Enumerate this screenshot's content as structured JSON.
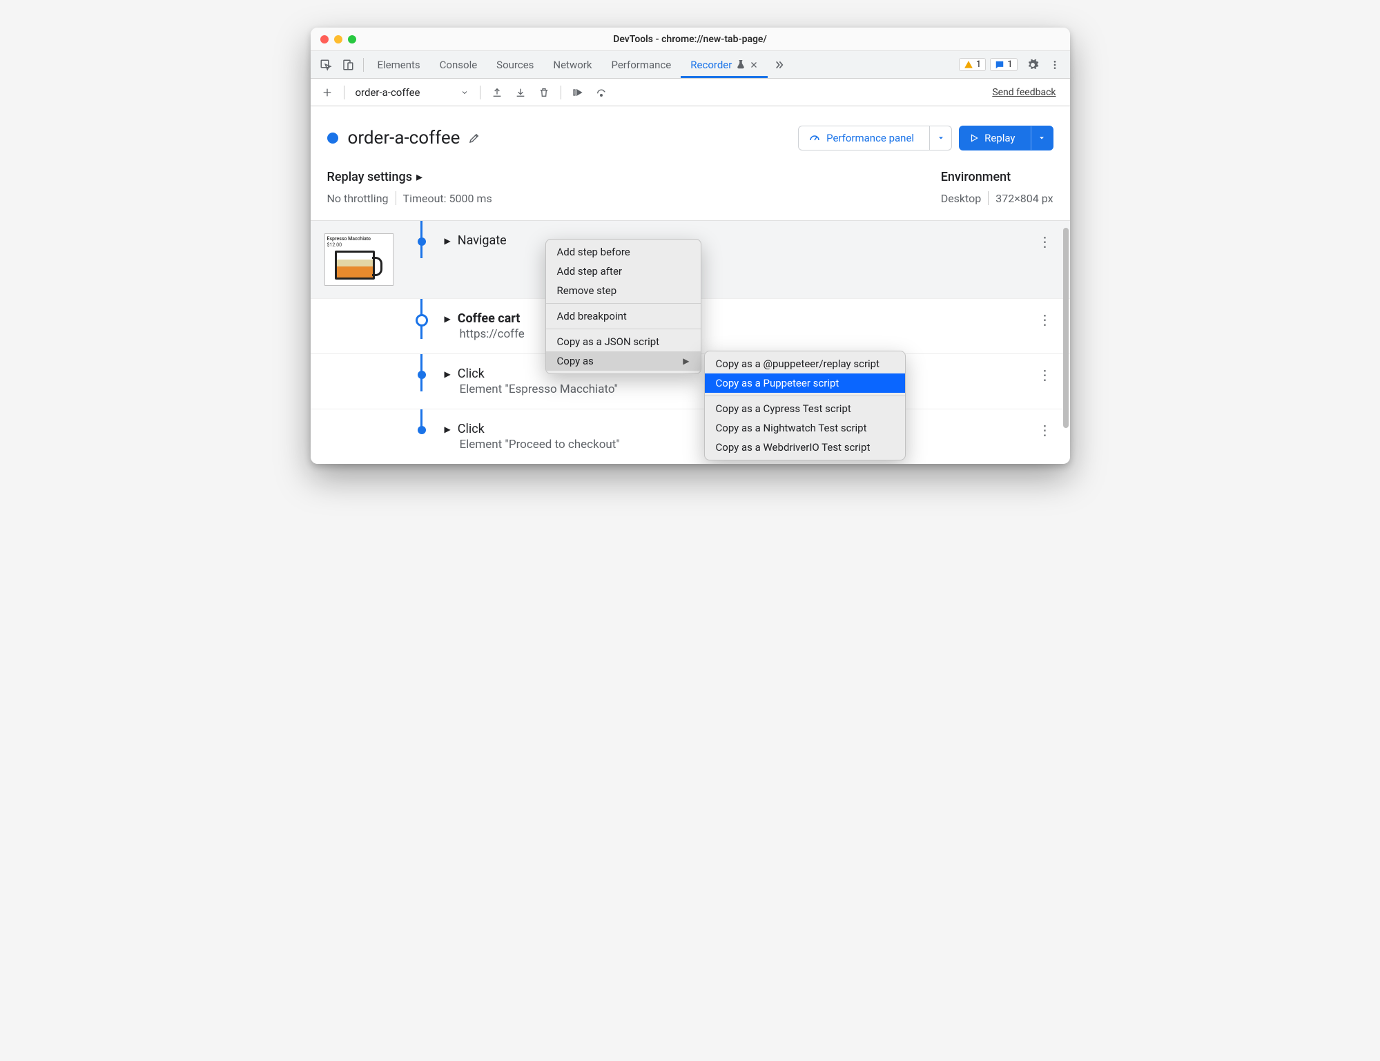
{
  "window": {
    "title": "DevTools - chrome://new-tab-page/"
  },
  "tabs": {
    "items": [
      "Elements",
      "Console",
      "Sources",
      "Network",
      "Performance"
    ],
    "recorder": "Recorder",
    "warnings_count": "1",
    "messages_count": "1"
  },
  "toolbar": {
    "recording_name": "order-a-coffee",
    "send_feedback": "Send feedback"
  },
  "header": {
    "recording_title": "order-a-coffee",
    "perf_button": "Performance panel",
    "replay_button": "Replay"
  },
  "settings": {
    "replay_label": "Replay settings",
    "throttling": "No throttling",
    "timeout": "Timeout: 5000 ms",
    "env_label": "Environment",
    "env_device": "Desktop",
    "env_size": "372×804 px"
  },
  "thumb": {
    "label1": "Espresso Macchiato",
    "label2": "$12.00",
    "foam": "milk foam",
    "fill": "espresso"
  },
  "steps": [
    {
      "title": "Navigate",
      "bold": false,
      "subtitle": ""
    },
    {
      "title": "Coffee cart",
      "bold": true,
      "subtitle": "https://coffe"
    },
    {
      "title": "Click",
      "bold": false,
      "subtitle": "Element \"Espresso Macchiato\""
    },
    {
      "title": "Click",
      "bold": false,
      "subtitle": "Element \"Proceed to checkout\""
    }
  ],
  "context_menu": {
    "add_before": "Add step before",
    "add_after": "Add step after",
    "remove": "Remove step",
    "breakpoint": "Add breakpoint",
    "copy_json": "Copy as a JSON script",
    "copy_as": "Copy as"
  },
  "submenu": {
    "puppeteer_replay": "Copy as a @puppeteer/replay script",
    "puppeteer": "Copy as a Puppeteer script",
    "cypress": "Copy as a Cypress Test script",
    "nightwatch": "Copy as a Nightwatch Test script",
    "webdriverio": "Copy as a WebdriverIO Test script"
  }
}
